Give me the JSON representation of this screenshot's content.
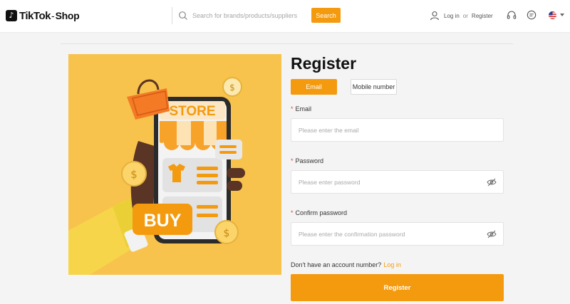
{
  "header": {
    "logo": {
      "brand": "TikTok",
      "dash": "-",
      "suffix": "Shop"
    },
    "search": {
      "placeholder": "Search for brands/products/suppliers",
      "button_label": "Search"
    },
    "user": {
      "login_label": "Log in",
      "or_label": "or",
      "register_label": "Register"
    },
    "icons": [
      "user-icon",
      "headset-icon",
      "chat-icon",
      "us-flag-icon",
      "chevron-down-icon"
    ]
  },
  "hero": {
    "store_sign": "STORE",
    "buy_label": "BUY",
    "colors": {
      "background": "#f8c34d",
      "accent": "#f49a0e"
    }
  },
  "form": {
    "title": "Register",
    "tabs": [
      {
        "label": "Email",
        "active": true
      },
      {
        "label": "Mobile number",
        "active": false
      }
    ],
    "fields": [
      {
        "required_mark": "*",
        "label": "Email",
        "placeholder": "Please enter the email",
        "value": ""
      },
      {
        "required_mark": "*",
        "label": "Password",
        "placeholder": "Please enter password",
        "value": ""
      },
      {
        "required_mark": "*",
        "label": "Confirm password",
        "placeholder": "Please enter the confirmation password",
        "value": ""
      }
    ],
    "login_hint": "Don't have an account number?",
    "login_link": "Log in",
    "submit_label": "Register"
  },
  "colors": {
    "primary": "#f49a0e",
    "required": "#e34b2a"
  }
}
